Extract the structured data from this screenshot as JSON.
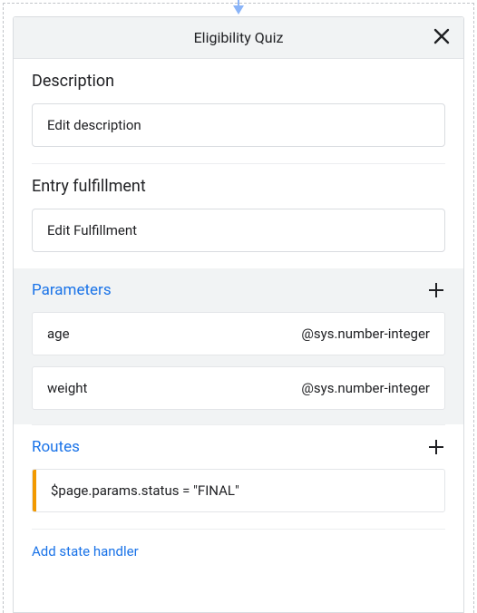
{
  "header": {
    "title": "Eligibility Quiz"
  },
  "description": {
    "title": "Description",
    "edit_label": "Edit description"
  },
  "entry": {
    "title": "Entry fulfillment",
    "edit_label": "Edit Fulfillment"
  },
  "parameters": {
    "title": "Parameters",
    "items": [
      {
        "name": "age",
        "type": "@sys.number-integer"
      },
      {
        "name": "weight",
        "type": "@sys.number-integer"
      }
    ]
  },
  "routes": {
    "title": "Routes",
    "items": [
      {
        "condition": "$page.params.status = \"FINAL\""
      }
    ]
  },
  "state_handler": {
    "add_label": "Add state handler"
  }
}
